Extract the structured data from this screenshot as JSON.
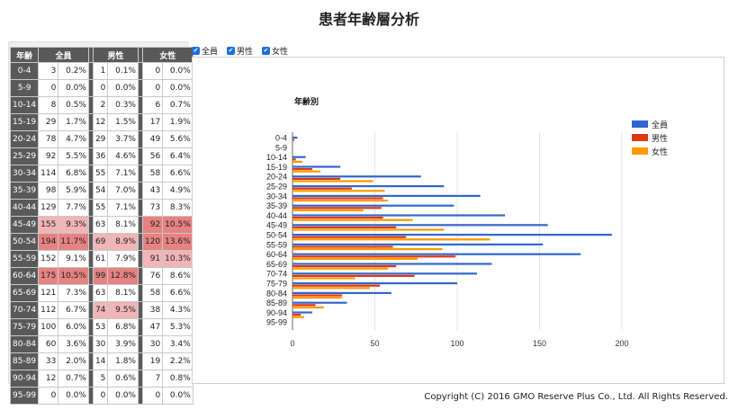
{
  "title": "患者年齢層分析",
  "table": {
    "headers": [
      "年齢",
      "全員",
      "男性",
      "女性"
    ],
    "rows": [
      {
        "age": "0-4",
        "all": 3,
        "all_pct": "0.2%",
        "m": 1,
        "m_pct": "0.1%",
        "f": 0,
        "f_pct": "0.0%"
      },
      {
        "age": "5-9",
        "all": 0,
        "all_pct": "0.0%",
        "m": 0,
        "m_pct": "0.0%",
        "f": 0,
        "f_pct": "0.0%"
      },
      {
        "age": "10-14",
        "all": 8,
        "all_pct": "0.5%",
        "m": 2,
        "m_pct": "0.3%",
        "f": 6,
        "f_pct": "0.7%"
      },
      {
        "age": "15-19",
        "all": 29,
        "all_pct": "1.7%",
        "m": 12,
        "m_pct": "1.5%",
        "f": 17,
        "f_pct": "1.9%"
      },
      {
        "age": "20-24",
        "all": 78,
        "all_pct": "4.7%",
        "m": 29,
        "m_pct": "3.7%",
        "f": 49,
        "f_pct": "5.6%"
      },
      {
        "age": "25-29",
        "all": 92,
        "all_pct": "5.5%",
        "m": 36,
        "m_pct": "4.6%",
        "f": 56,
        "f_pct": "6.4%"
      },
      {
        "age": "30-34",
        "all": 114,
        "all_pct": "6.8%",
        "m": 55,
        "m_pct": "7.1%",
        "f": 58,
        "f_pct": "6.6%"
      },
      {
        "age": "35-39",
        "all": 98,
        "all_pct": "5.9%",
        "m": 54,
        "m_pct": "7.0%",
        "f": 43,
        "f_pct": "4.9%"
      },
      {
        "age": "40-44",
        "all": 129,
        "all_pct": "7.7%",
        "m": 55,
        "m_pct": "7.1%",
        "f": 73,
        "f_pct": "8.3%"
      },
      {
        "age": "45-49",
        "all": 155,
        "all_pct": "9.3%",
        "m": 63,
        "m_pct": "8.1%",
        "f": 92,
        "f_pct": "10.5%"
      },
      {
        "age": "50-54",
        "all": 194,
        "all_pct": "11.7%",
        "m": 69,
        "m_pct": "8.9%",
        "f": 120,
        "f_pct": "13.6%"
      },
      {
        "age": "55-59",
        "all": 152,
        "all_pct": "9.1%",
        "m": 61,
        "m_pct": "7.9%",
        "f": 91,
        "f_pct": "10.3%"
      },
      {
        "age": "60-64",
        "all": 175,
        "all_pct": "10.5%",
        "m": 99,
        "m_pct": "12.8%",
        "f": 76,
        "f_pct": "8.6%"
      },
      {
        "age": "65-69",
        "all": 121,
        "all_pct": "7.3%",
        "m": 63,
        "m_pct": "8.1%",
        "f": 58,
        "f_pct": "6.6%"
      },
      {
        "age": "70-74",
        "all": 112,
        "all_pct": "6.7%",
        "m": 74,
        "m_pct": "9.5%",
        "f": 38,
        "f_pct": "4.3%"
      },
      {
        "age": "75-79",
        "all": 100,
        "all_pct": "6.0%",
        "m": 53,
        "m_pct": "6.8%",
        "f": 47,
        "f_pct": "5.3%"
      },
      {
        "age": "80-84",
        "all": 60,
        "all_pct": "3.6%",
        "m": 30,
        "m_pct": "3.9%",
        "f": 30,
        "f_pct": "3.4%"
      },
      {
        "age": "85-89",
        "all": 33,
        "all_pct": "2.0%",
        "m": 14,
        "m_pct": "1.8%",
        "f": 19,
        "f_pct": "2.2%"
      },
      {
        "age": "90-94",
        "all": 12,
        "all_pct": "0.7%",
        "m": 5,
        "m_pct": "0.6%",
        "f": 7,
        "f_pct": "0.8%"
      },
      {
        "age": "95-99",
        "all": 0,
        "all_pct": "0.0%",
        "m": 0,
        "m_pct": "0.0%",
        "f": 0,
        "f_pct": "0.0%"
      }
    ],
    "highlight_colors": {
      "strong": "#e68282",
      "mid": "#f1b5b5"
    },
    "highlights": {
      "all": {
        "45-49": "mid",
        "50-54": "strong",
        "60-64": "strong"
      },
      "m": {
        "50-54": "mid",
        "60-64": "strong",
        "70-74": "mid"
      },
      "f": {
        "45-49": "strong",
        "50-54": "strong",
        "55-59": "mid"
      }
    }
  },
  "toggles": [
    {
      "label": "全員",
      "checked": true
    },
    {
      "label": "男性",
      "checked": true
    },
    {
      "label": "女性",
      "checked": true
    }
  ],
  "chart_data": {
    "type": "bar",
    "orientation": "horizontal",
    "title": "年齢別",
    "categories": [
      "0-4",
      "5-9",
      "10-14",
      "15-19",
      "20-24",
      "25-29",
      "30-34",
      "35-39",
      "40-44",
      "45-49",
      "50-54",
      "55-59",
      "60-64",
      "65-69",
      "70-74",
      "75-79",
      "80-84",
      "85-89",
      "90-94",
      "95-99"
    ],
    "series": [
      {
        "name": "全員",
        "color": "#3366cc",
        "values": [
          3,
          0,
          8,
          29,
          78,
          92,
          114,
          98,
          129,
          155,
          194,
          152,
          175,
          121,
          112,
          100,
          60,
          33,
          12,
          0
        ]
      },
      {
        "name": "男性",
        "color": "#dc3912",
        "values": [
          1,
          0,
          2,
          12,
          29,
          36,
          55,
          54,
          55,
          63,
          69,
          61,
          99,
          63,
          74,
          53,
          30,
          14,
          5,
          0
        ]
      },
      {
        "name": "女性",
        "color": "#ff9900",
        "values": [
          0,
          0,
          6,
          17,
          49,
          56,
          58,
          43,
          73,
          92,
          120,
          91,
          76,
          58,
          38,
          47,
          30,
          19,
          7,
          0
        ]
      }
    ],
    "x_ticks": [
      0,
      50,
      100,
      150,
      200
    ],
    "xlim": [
      0,
      200
    ],
    "grid": true,
    "legend": "right"
  },
  "copyright": "Copyright (C) 2016 GMO Reserve Plus Co., Ltd. All Rights Reserved."
}
